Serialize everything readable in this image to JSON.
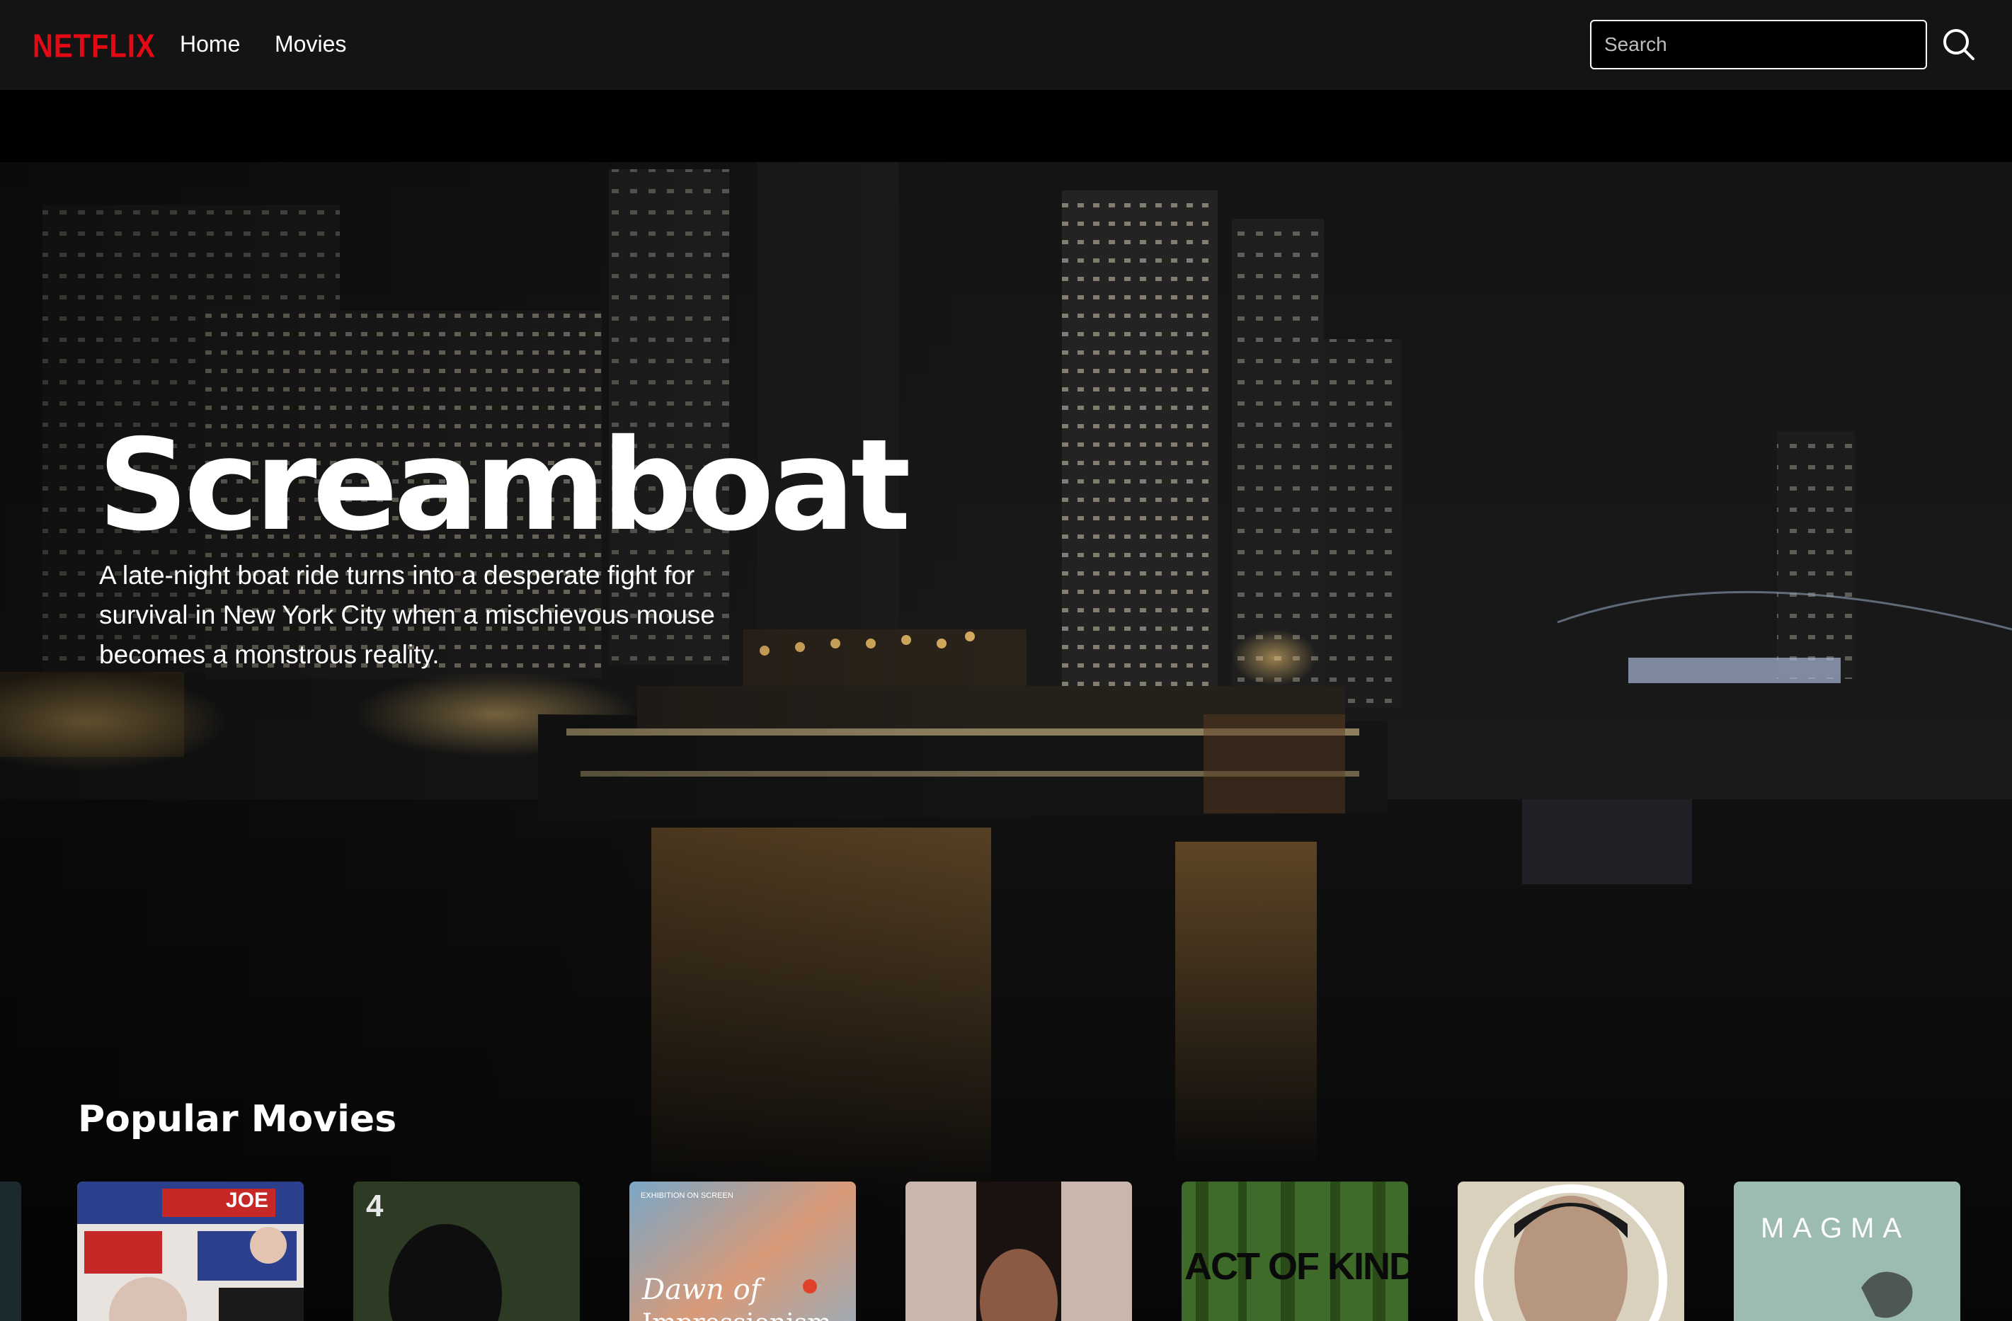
{
  "nav": {
    "logo": "NETFLIX",
    "links": [
      "Home",
      "Movies"
    ],
    "search_placeholder": "Search",
    "search_icon": "search-icon"
  },
  "hero": {
    "title": "Screamboat",
    "description": "A late-night boat ride turns into a desperate fight for survival in New York City when a mischievous mouse becomes a monstrous reality."
  },
  "popular": {
    "title": "Popular Movies",
    "cards": [
      {
        "poster_text": "JOE"
      },
      {
        "poster_text": "4"
      },
      {
        "poster_text": "Dawn of Impressionism",
        "poster_line1": "Dawn of",
        "poster_line2": "Impressionism",
        "poster_corner": "EXHIBITION ON SCREEN"
      },
      {
        "poster_text": ""
      },
      {
        "poster_text": "ACT OF KINDNESS"
      },
      {
        "poster_text": ""
      },
      {
        "poster_text": "MAGMA"
      }
    ]
  },
  "colors": {
    "brand": "#e50914",
    "navbar": "#141414",
    "text": "#ffffff"
  }
}
